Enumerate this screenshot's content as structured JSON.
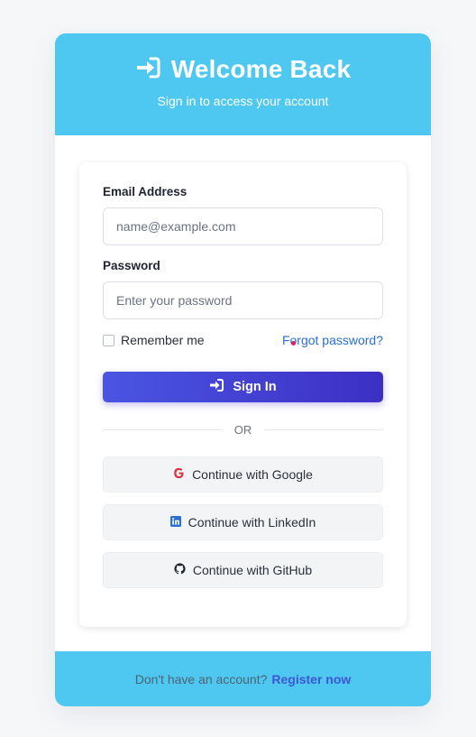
{
  "header": {
    "title": "Welcome Back",
    "subtitle": "Sign in to access your account",
    "icon": "sign-in-icon"
  },
  "form": {
    "email_label": "Email Address",
    "email_placeholder": "name@example.com",
    "email_value": "",
    "password_label": "Password",
    "password_placeholder": "Enter your password",
    "password_value": "",
    "remember_label": "Remember me",
    "remember_checked": false,
    "forgot_label": "Forgot password?",
    "signin_label": "Sign In"
  },
  "divider": {
    "label": "OR"
  },
  "social": {
    "google_label": "Continue with Google",
    "linkedin_label": "Continue with LinkedIn",
    "github_label": "Continue with GitHub"
  },
  "footer": {
    "prompt": "Don't have an account?",
    "register_label": "Register now"
  },
  "colors": {
    "header_bg": "#4ec8f0",
    "primary": "#4a55e2",
    "link": "#2a6fd6",
    "google": "#d93344",
    "linkedin": "#2a6fd6",
    "github": "#1f2430"
  }
}
